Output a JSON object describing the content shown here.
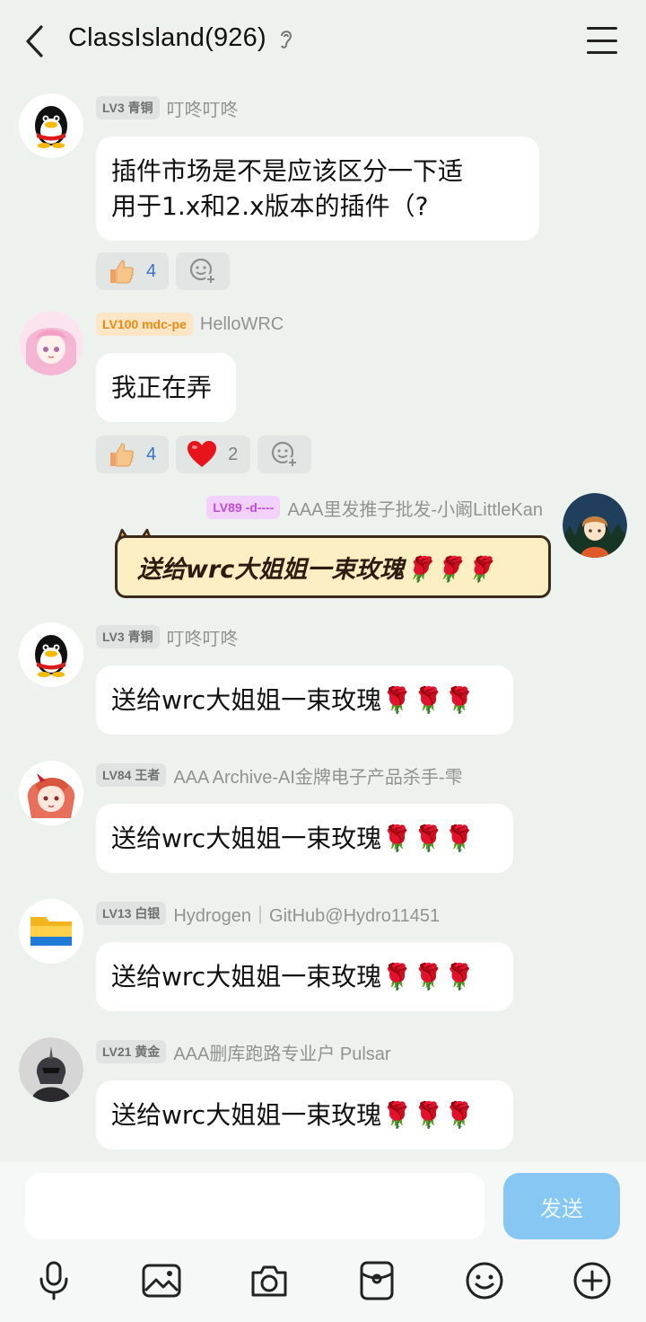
{
  "header": {
    "title": "ClassIsland(926)",
    "back_icon": "chevron-left-icon",
    "ear_icon": "ear-icon",
    "menu_icon": "hamburger-menu-icon"
  },
  "messages": [
    {
      "badge": "LV3 青铜",
      "nick": "叮咚叮咚",
      "avatar_icon": "qq-penguin-avatar",
      "text_line1": "插件市场是不是应该区分一下适",
      "text_line2": "用于1.x和2.x版本的插件（?",
      "reactions": [
        {
          "emoji": "thumbs-up-icon",
          "count": "4"
        }
      ]
    },
    {
      "badge": "LV100 mdc-pe",
      "nick": "HelloWRC",
      "avatar_icon": "pink-hair-anime-avatar",
      "text": "我正在弄",
      "reactions": [
        {
          "emoji": "thumbs-up-icon",
          "count": "4"
        },
        {
          "emoji": "heart-icon",
          "count": "2"
        }
      ]
    },
    {
      "badge": "LV89 -d----",
      "nick": "AAA里发推子批发-小阚LittleKan",
      "avatar_icon": "anime-boy-forest-avatar",
      "text": "送给wrc大姐姐一束玫瑰🌹🌹🌹"
    },
    {
      "badge": "LV3 青铜",
      "nick": "叮咚叮咚",
      "avatar_icon": "qq-penguin-avatar",
      "text": "送给wrc大姐姐一束玫瑰🌹🌹🌹"
    },
    {
      "badge": "LV84 王者",
      "nick": "AAA Archive-AI金牌电子产品杀手-雫",
      "avatar_icon": "red-hair-anime-avatar",
      "text": "送给wrc大姐姐一束玫瑰🌹🌹🌹"
    },
    {
      "badge": "LV13 白银",
      "nick": "Hydrogen｜GitHub@Hydro11451",
      "avatar_icon": "folder-avatar",
      "text": "送给wrc大姐姐一束玫瑰🌹🌹🌹"
    },
    {
      "badge": "LV21 黄金",
      "nick": "AAA删库跑路专业户 Pulsar",
      "avatar_icon": "dark-knight-avatar",
      "text": "送给wrc大姐姐一束玫瑰🌹🌹🌹"
    }
  ],
  "input": {
    "placeholder": "",
    "send_label": "发送"
  },
  "toolbar": [
    {
      "icon": "microphone-icon"
    },
    {
      "icon": "image-icon"
    },
    {
      "icon": "camera-icon"
    },
    {
      "icon": "red-packet-icon"
    },
    {
      "icon": "emoji-icon"
    },
    {
      "icon": "plus-icon"
    }
  ],
  "colors": {
    "background": "#eef2ef",
    "send_button": "#86c7f4",
    "badge_orange": "#ec8a10",
    "badge_purple": "#c04adf",
    "reaction_count": "#3a73c8"
  }
}
